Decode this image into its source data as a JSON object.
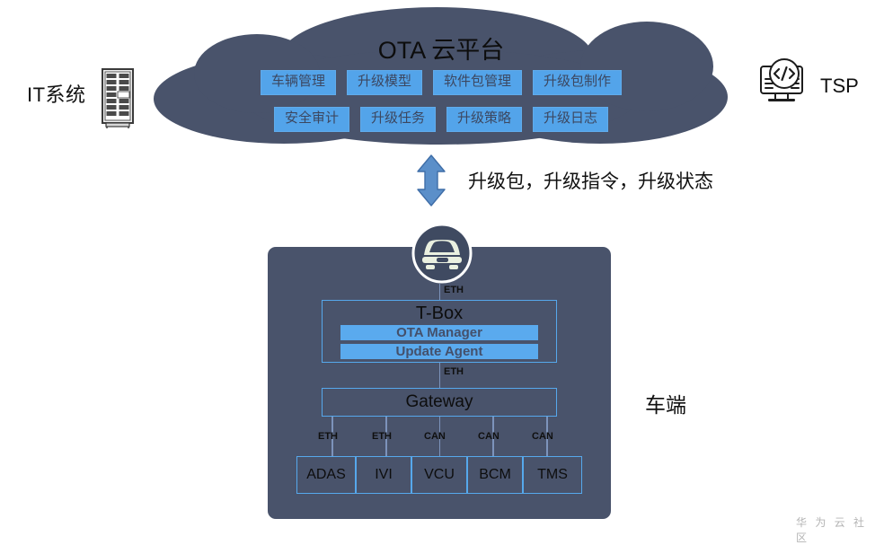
{
  "diagram": {
    "title": "OTA 云平台 architecture",
    "colors": {
      "cloud_fill": "#49536b",
      "panel_fill": "#49536b",
      "accent_blue": "#53a4ea",
      "box_border": "#56a8ec",
      "arrow_fill": "#5b8fc9",
      "connector_line": "#7d93bb",
      "text_dark": "#0d0d0d",
      "watermark": "#b4b4b4"
    }
  },
  "left": {
    "label": "IT系统",
    "icon": "server-rack-icon"
  },
  "right": {
    "label": "TSP",
    "icon": "code-monitor-icon"
  },
  "cloud": {
    "title": "OTA 云平台",
    "row1": [
      {
        "label": "车辆管理"
      },
      {
        "label": "升级模型"
      },
      {
        "label": "软件包管理"
      },
      {
        "label": "升级包制作"
      }
    ],
    "row2": [
      {
        "label": "安全审计"
      },
      {
        "label": "升级任务"
      },
      {
        "label": "升级策略"
      },
      {
        "label": "升级日志"
      }
    ]
  },
  "link": {
    "arrow_icon": "double-arrow-vertical-icon",
    "label": "升级包，升级指令，升级状态"
  },
  "vehicle": {
    "side_label": "车端",
    "car_icon": "car-front-icon",
    "tbox": {
      "title": "T-Box",
      "modules": [
        {
          "label": "OTA Manager"
        },
        {
          "label": "Update Agent"
        }
      ]
    },
    "gateway": {
      "label": "Gateway"
    },
    "links": {
      "car_to_tbox": "ETH",
      "tbox_to_gateway": "ETH"
    },
    "ecus": [
      {
        "label": "ADAS",
        "bus": "ETH"
      },
      {
        "label": "IVI",
        "bus": "ETH"
      },
      {
        "label": "VCU",
        "bus": "CAN"
      },
      {
        "label": "BCM",
        "bus": "CAN"
      },
      {
        "label": "TMS",
        "bus": "CAN"
      }
    ]
  },
  "watermark": {
    "text": "华 为 云 社 区"
  }
}
